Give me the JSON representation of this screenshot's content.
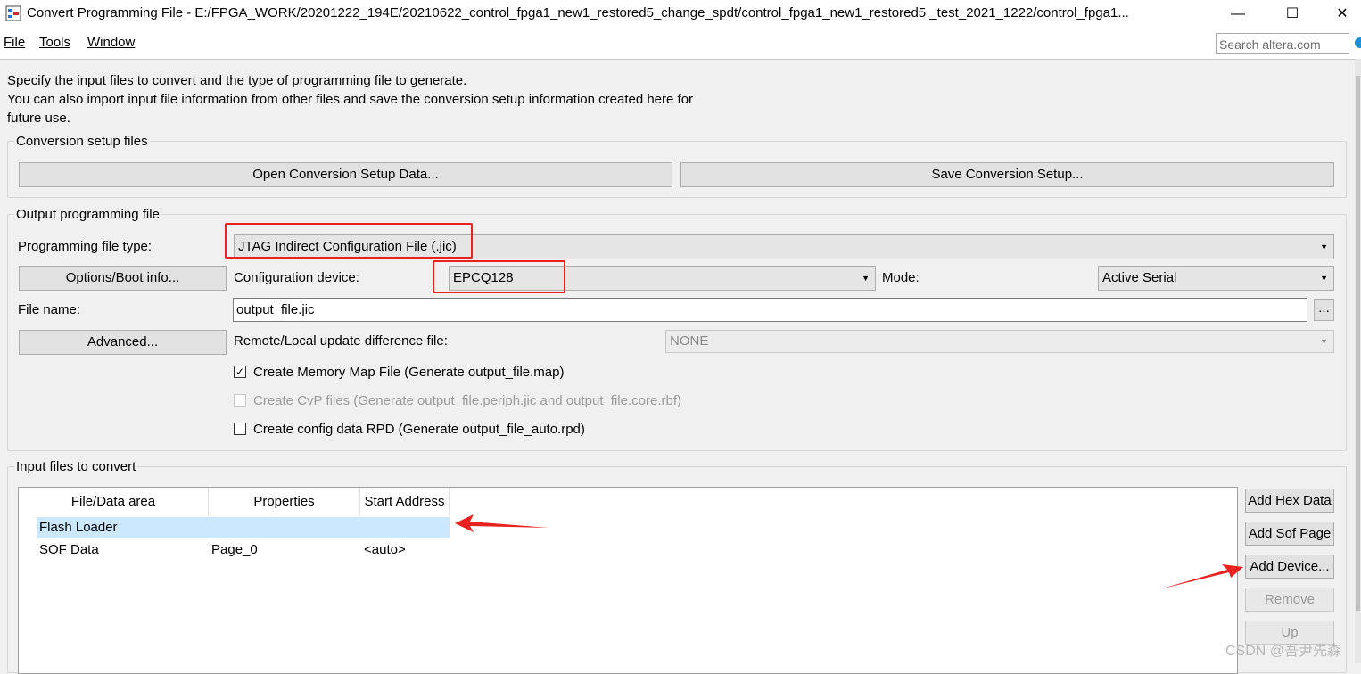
{
  "window": {
    "title": "Convert Programming File - E:/FPGA_WORK/20201222_194E/20210622_control_fpga1_new1_restored5_change_spdt/control_fpga1_new1_restored5 _test_2021_1222/control_fpga1...",
    "minimize": "—",
    "maximize": "☐",
    "close": "✕"
  },
  "menu": {
    "file": "File",
    "tools": "Tools",
    "window": "Window"
  },
  "search": {
    "placeholder": "Search altera.com"
  },
  "intro": {
    "line1": "Specify the input files to convert and the type of programming file to generate.",
    "line2": "You can also import input file information from other files and save the conversion setup information created here for",
    "line3": "future use."
  },
  "conversion_setup": {
    "title": "Conversion setup files",
    "open_button": "Open Conversion Setup Data...",
    "save_button": "Save Conversion Setup..."
  },
  "output": {
    "title": "Output programming file",
    "type_label": "Programming file type:",
    "type_value": "JTAG Indirect Configuration File (.jic)",
    "options_button": "Options/Boot info...",
    "device_label": "Configuration device:",
    "device_value": "EPCQ128",
    "mode_label": "Mode:",
    "mode_value": "Active Serial",
    "filename_label": "File name:",
    "filename_value": "output_file.jic",
    "browse_button": "...",
    "advanced_button": "Advanced...",
    "remote_label": "Remote/Local update difference file:",
    "remote_value": "NONE",
    "check_map_label": "Create Memory Map File (Generate output_file.map)",
    "check_map_checked": true,
    "check_cvp_label": "Create CvP files (Generate output_file.periph.jic and output_file.core.rbf)",
    "check_rpd_label": "Create config data RPD (Generate output_file_auto.rpd)"
  },
  "input_files": {
    "title": "Input files to convert",
    "columns": [
      "File/Data area",
      "Properties",
      "Start Address"
    ],
    "rows": [
      {
        "file": "Flash Loader",
        "properties": "",
        "start": ""
      },
      {
        "file": "SOF Data",
        "properties": "Page_0",
        "start": "<auto>"
      }
    ],
    "buttons": {
      "add_hex": "Add Hex Data",
      "add_sof": "Add Sof Page",
      "add_device": "Add Device...",
      "remove": "Remove",
      "up": "Up"
    }
  },
  "colors": {
    "annotation": "#e8231f",
    "selection": "#cce8ff"
  },
  "watermark": "CSDN @吾尹先森"
}
